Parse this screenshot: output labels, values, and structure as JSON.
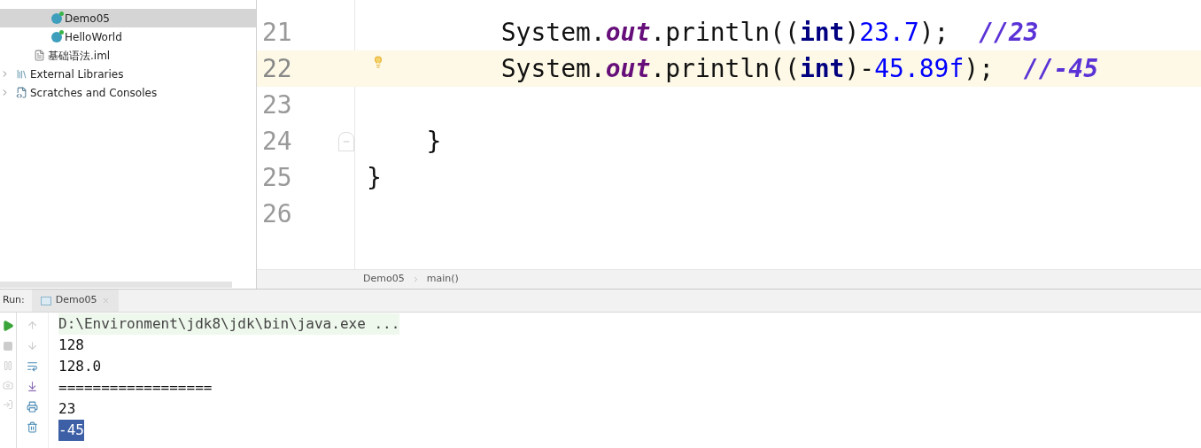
{
  "project_tree": [
    {
      "label": "Demo05",
      "kind": "class",
      "selected": true
    },
    {
      "label": "HelloWorld",
      "kind": "class",
      "selected": false
    },
    {
      "label": "基础语法.iml",
      "kind": "module_file",
      "selected": false
    },
    {
      "label": "External Libraries",
      "kind": "libraries",
      "selected": false,
      "expanded": false
    },
    {
      "label": "Scratches and Consoles",
      "kind": "scratches",
      "selected": false,
      "expanded": false
    }
  ],
  "editor": {
    "lines": [
      {
        "number": "21",
        "current": false,
        "lightbulb": false,
        "foldable": false,
        "tokens": [
          {
            "kind": "plain",
            "text": "         System."
          },
          {
            "kind": "field",
            "text": "out"
          },
          {
            "kind": "plain",
            "text": ".println(("
          },
          {
            "kind": "keyword",
            "text": "int"
          },
          {
            "kind": "plain",
            "text": ")"
          },
          {
            "kind": "number",
            "text": "23.7"
          },
          {
            "kind": "plain",
            "text": ");  "
          },
          {
            "kind": "comment",
            "text": "//23"
          }
        ]
      },
      {
        "number": "22",
        "current": true,
        "lightbulb": true,
        "foldable": false,
        "tokens": [
          {
            "kind": "plain",
            "text": "         System."
          },
          {
            "kind": "field",
            "text": "out"
          },
          {
            "kind": "plain",
            "text": ".println(("
          },
          {
            "kind": "keyword",
            "text": "int"
          },
          {
            "kind": "plain",
            "text": ")-"
          },
          {
            "kind": "number",
            "text": "45.89f"
          },
          {
            "kind": "plain",
            "text": ");  "
          },
          {
            "kind": "comment",
            "text": "//-45"
          }
        ]
      },
      {
        "number": "23",
        "current": false,
        "lightbulb": false,
        "foldable": false
      },
      {
        "number": "24",
        "current": false,
        "lightbulb": false,
        "foldable": true,
        "tokens": [
          {
            "kind": "plain",
            "text": "    }"
          }
        ]
      },
      {
        "number": "25",
        "current": false,
        "lightbulb": false,
        "foldable": false,
        "tokens": [
          {
            "kind": "plain",
            "text": "}"
          }
        ]
      },
      {
        "number": "26",
        "current": false,
        "lightbulb": false,
        "foldable": false
      }
    ],
    "breadcrumbs": [
      "Demo05",
      "main()"
    ]
  },
  "run_panel": {
    "label": "Run:",
    "tabs": [
      {
        "label": "Demo05",
        "selected": true
      }
    ],
    "console": [
      {
        "kind": "command",
        "text": "D:\\Environment\\jdk8\\jdk\\bin\\java.exe ..."
      },
      {
        "kind": "output",
        "text": "128",
        "selected": false
      },
      {
        "kind": "output",
        "text": "128.0",
        "selected": false
      },
      {
        "kind": "output",
        "text": "==================",
        "selected": false
      },
      {
        "kind": "output",
        "text": "23",
        "selected": false
      },
      {
        "kind": "output",
        "text": "-45",
        "selected": true
      }
    ]
  }
}
